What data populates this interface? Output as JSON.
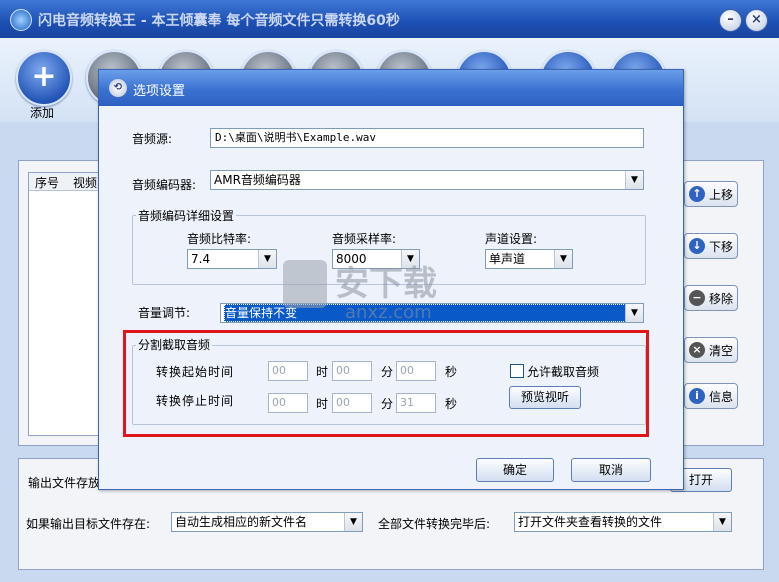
{
  "main": {
    "title": "闪电音频转换王 - 本王倾囊奉 每个音频文件只需转换60秒",
    "toolbar": {
      "add_label": "添加"
    },
    "list": {
      "columns": [
        "序号",
        "视频"
      ]
    },
    "side_buttons": [
      "上移",
      "下移",
      "移除",
      "清空",
      "信息"
    ],
    "output_label": "输出文件存放",
    "open_button": "打开",
    "exists_label": "如果输出目标文件存在:",
    "exists_value": "自动生成相应的新文件名",
    "after_label": "全部文件转换完毕后:",
    "after_value": "打开文件夹查看转换的文件"
  },
  "dialog": {
    "title": "选项设置",
    "source_label": "音频源:",
    "source_value": "D:\\桌面\\说明书\\Example.wav",
    "encoder_label": "音频编码器:",
    "encoder_value": "AMR音频编码器",
    "detail_group": "音频编码详细设置",
    "bitrate_label": "音频比特率:",
    "bitrate_value": "7.4",
    "samplerate_label": "音频采样率:",
    "samplerate_value": "8000",
    "channel_label": "声道设置:",
    "channel_value": "单声道",
    "volume_label": "音量调节:",
    "volume_value": "音量保持不变",
    "split_group": "分割截取音频",
    "start_label": "转换起始时间",
    "stop_label": "转换停止时间",
    "start_h": "00",
    "start_m": "00",
    "start_s": "00",
    "stop_h": "00",
    "stop_m": "00",
    "stop_s": "31",
    "unit_h": "时",
    "unit_m": "分",
    "unit_s": "秒",
    "allow_split_label": "允许截取音频",
    "preview_button": "预览视听",
    "ok_button": "确定",
    "cancel_button": "取消"
  },
  "watermark": {
    "text": "安下载",
    "sub": "anxz.com"
  },
  "colors": {
    "highlight": "#e0161b",
    "selection": "#0a59c9",
    "titlebar": "#2c60c0"
  }
}
